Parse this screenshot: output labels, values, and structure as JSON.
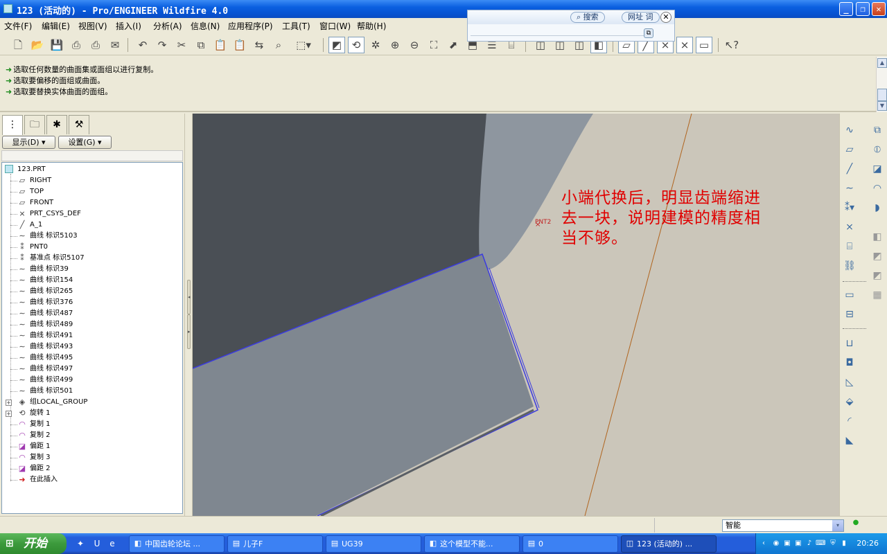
{
  "window": {
    "title": "123 (活动的) - Pro/ENGINEER Wildfire 4.0",
    "min": "_",
    "max": "❐",
    "close": "✕"
  },
  "menu": [
    "文件(F)",
    "编辑(E)",
    "视图(V)",
    "插入(I)",
    "分析(A)",
    "信息(N)",
    "应用程序(P)",
    "工具(T)",
    "窗口(W)",
    "帮助(H)"
  ],
  "search_popup": {
    "search_label": "搜索",
    "url_label": "网址 词",
    "close": "✕",
    "mini": "⧉"
  },
  "messages": [
    "选取任何数量的曲面集或面组以进行复制。",
    "选取要偏移的面组或曲面。",
    "选取要替换实体曲面的面组。"
  ],
  "left_panel": {
    "show_button": "显示(D) ▾",
    "settings_button": "设置(G) ▾"
  },
  "tree": {
    "root": "123.PRT",
    "items": [
      {
        "icon": "plane-icon",
        "glyph": "▱",
        "label": "RIGHT",
        "depth": 1
      },
      {
        "icon": "plane-icon",
        "glyph": "▱",
        "label": "TOP",
        "depth": 1
      },
      {
        "icon": "plane-icon",
        "glyph": "▱",
        "label": "FRONT",
        "depth": 1
      },
      {
        "icon": "csys-icon",
        "glyph": "⨯",
        "label": "PRT_CSYS_DEF",
        "depth": 1
      },
      {
        "icon": "axis-icon",
        "glyph": "╱",
        "label": "A_1",
        "depth": 1
      },
      {
        "icon": "curve-icon",
        "glyph": "∼",
        "label": "曲线 标识5103",
        "depth": 1
      },
      {
        "icon": "datum-point-icon",
        "glyph": "⁑",
        "label": "PNT0",
        "depth": 1
      },
      {
        "icon": "datum-point-icon",
        "glyph": "⁑",
        "label": "基准点 标识5107",
        "depth": 1
      },
      {
        "icon": "curve-icon",
        "glyph": "∼",
        "label": "曲线 标识39",
        "depth": 1
      },
      {
        "icon": "curve-icon",
        "glyph": "∼",
        "label": "曲线 标识154",
        "depth": 1
      },
      {
        "icon": "curve-icon",
        "glyph": "∼",
        "label": "曲线 标识265",
        "depth": 1
      },
      {
        "icon": "curve-icon",
        "glyph": "∼",
        "label": "曲线 标识376",
        "depth": 1
      },
      {
        "icon": "curve-icon",
        "glyph": "∼",
        "label": "曲线 标识487",
        "depth": 1
      },
      {
        "icon": "curve-icon",
        "glyph": "∼",
        "label": "曲线 标识489",
        "depth": 1
      },
      {
        "icon": "curve-icon",
        "glyph": "∼",
        "label": "曲线 标识491",
        "depth": 1
      },
      {
        "icon": "curve-icon",
        "glyph": "∼",
        "label": "曲线 标识493",
        "depth": 1
      },
      {
        "icon": "curve-icon",
        "glyph": "∼",
        "label": "曲线 标识495",
        "depth": 1
      },
      {
        "icon": "curve-icon",
        "glyph": "∼",
        "label": "曲线 标识497",
        "depth": 1
      },
      {
        "icon": "curve-icon",
        "glyph": "∼",
        "label": "曲线 标识499",
        "depth": 1
      },
      {
        "icon": "curve-icon",
        "glyph": "∼",
        "label": "曲线 标识501",
        "depth": 1
      },
      {
        "icon": "group-icon",
        "glyph": "◈",
        "label": "组LOCAL_GROUP",
        "depth": 1,
        "expand": "+"
      },
      {
        "icon": "revolve-icon",
        "glyph": "⟲",
        "label": "旋转 1",
        "depth": 1,
        "expand": "+"
      },
      {
        "icon": "copy-icon",
        "glyph": "◠",
        "label": "复制 1",
        "depth": 1
      },
      {
        "icon": "copy-icon",
        "glyph": "◠",
        "label": "复制 2",
        "depth": 1
      },
      {
        "icon": "offset-icon",
        "glyph": "◪",
        "label": "偏距 1",
        "depth": 1
      },
      {
        "icon": "copy-icon",
        "glyph": "◠",
        "label": "复制 3",
        "depth": 1
      },
      {
        "icon": "offset-icon",
        "glyph": "◪",
        "label": "偏距 2",
        "depth": 1
      },
      {
        "icon": "insert-here-icon",
        "glyph": "➜",
        "label": "在此插入",
        "depth": 1
      }
    ]
  },
  "viewport": {
    "annotation": [
      "小端代换后，明显齿端缩进",
      "去一块，说明建模的精度相",
      "当不够。"
    ],
    "point_label": "PNT2",
    "annotation_color": "#E00000"
  },
  "status": {
    "filter_value": "智能",
    "filter_arrow": "▾",
    "indicator": "●"
  },
  "taskbar": {
    "start_label": "开始",
    "start_flag": "⊞",
    "quicklaunch": [
      {
        "icon": "gear-icon",
        "glyph": "✦"
      },
      {
        "icon": "u-icon",
        "glyph": "U"
      },
      {
        "icon": "ie-icon",
        "glyph": "e"
      }
    ],
    "tasks": [
      {
        "label": "中国齿轮论坛 ...",
        "icon": "browser-icon",
        "glyph": "◧"
      },
      {
        "label": "儿子F",
        "icon": "folder-icon",
        "glyph": "▤"
      },
      {
        "label": "UG39",
        "icon": "folder-icon",
        "glyph": "▤"
      },
      {
        "label": "这个模型不能...",
        "icon": "browser-icon",
        "glyph": "◧"
      },
      {
        "label": "0",
        "icon": "folder-icon",
        "glyph": "▤"
      },
      {
        "label": "123 (活动的) ...",
        "icon": "proe-icon",
        "glyph": "◫",
        "active": true
      }
    ],
    "clock": "20:26"
  },
  "colors": {
    "titlebar": "#0A5FE0",
    "chrome": "#ECE9D8",
    "viewport_bg": "#CBC6BA",
    "dark_surface": "#4A4F55",
    "light_surface": "#7F8790",
    "edge_highlight": "#3A3AE0",
    "datum_curve": "#B0641E"
  }
}
